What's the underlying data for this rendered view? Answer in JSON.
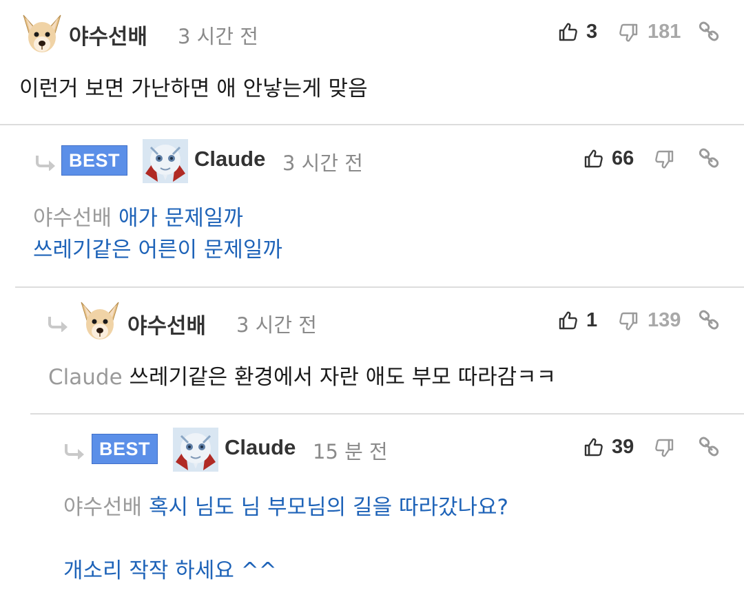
{
  "comments": [
    {
      "user": "야수선배",
      "time": "3 시간 전",
      "likes": "3",
      "dislikes": "181",
      "best": false,
      "text": "이런거 보면 가난하면 애 안낳는게 맞음"
    },
    {
      "user": "Claude",
      "time": "3 시간 전",
      "likes": "66",
      "dislikes": "",
      "best": true,
      "best_label": "BEST",
      "mention": "야수선배",
      "line1": "애가 문제일까",
      "line2": "쓰레기같은 어른이 문제일까"
    },
    {
      "user": "야수선배",
      "time": "3 시간 전",
      "likes": "1",
      "dislikes": "139",
      "best": false,
      "mention": "Claude",
      "text": "쓰레기같은 환경에서 자란 애도 부모 따라감ㅋㅋ"
    },
    {
      "user": "Claude",
      "time": "15 분 전",
      "likes": "39",
      "dislikes": "",
      "best": true,
      "best_label": "BEST",
      "mention": "야수선배",
      "line1": "혹시 님도 님 부모님의 길을 따라갔나요?",
      "line2": "개소리 작작 하세요 ^^"
    }
  ],
  "colors": {
    "best_badge": "#5b8fe8",
    "reply_text": "#1e63b8",
    "mention": "#9a9a9a",
    "separator": "#dcdcdc"
  },
  "icons": [
    "reply-arrow-icon",
    "thumbs-up-icon",
    "thumbs-down-icon",
    "link-icon",
    "dog-avatar",
    "robot-avatar"
  ]
}
